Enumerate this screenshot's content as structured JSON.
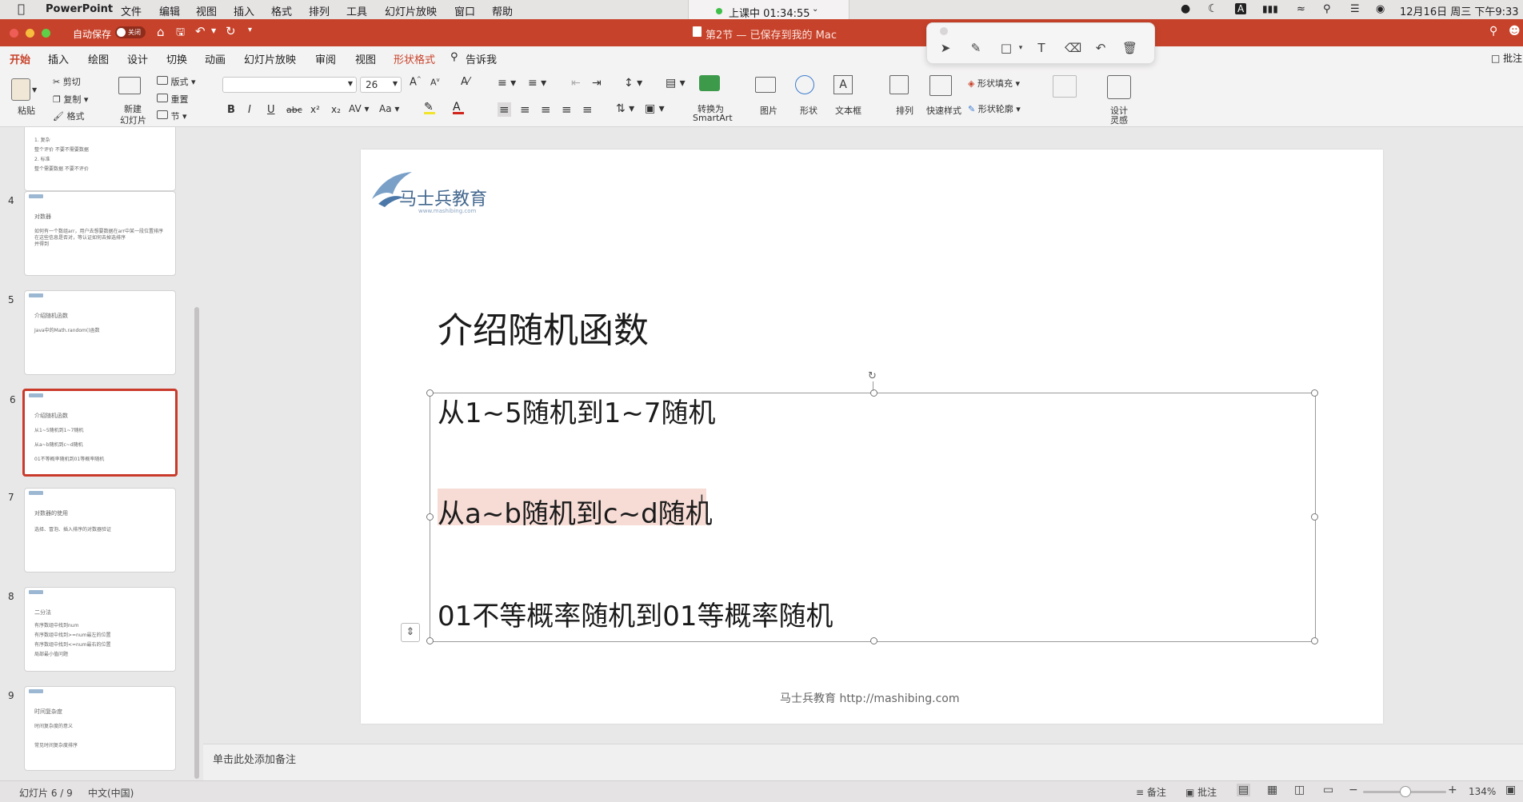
{
  "menubar": {
    "app": "PowerPoint",
    "items": [
      "文件",
      "编辑",
      "视图",
      "插入",
      "格式",
      "排列",
      "工具",
      "幻灯片放映",
      "窗口",
      "帮助"
    ],
    "recording": "上课中 01:34:55",
    "datetime": "12月16日 周三 下午9:33"
  },
  "titlebar": {
    "autosave": "自动保存",
    "toggle": "关闭",
    "title": "第2节 — 已保存到我的 Mac"
  },
  "tabs": [
    "开始",
    "插入",
    "绘图",
    "设计",
    "切换",
    "动画",
    "幻灯片放映",
    "审阅",
    "视图",
    "形状格式"
  ],
  "tell_me": "告诉我",
  "comments_btn": "批注",
  "toolbar": {
    "paste": "粘贴",
    "cut": "剪切",
    "copy": "复制",
    "format": "格式",
    "new_slide_1": "新建",
    "new_slide_2": "幻灯片",
    "layout": "版式",
    "reset": "重置",
    "section": "节",
    "font_name": "",
    "font_size": "26",
    "bold": "B",
    "italic": "I",
    "underline": "U",
    "strike": "abc",
    "sup": "x²",
    "sub": "x₂",
    "smartart_1": "转换为",
    "smartart_2": "SmartArt",
    "picture": "图片",
    "shape": "形状",
    "textbox": "文本框",
    "arrange": "排列",
    "quickstyle": "快速样式",
    "shape_fill": "形状填充",
    "shape_outline": "形状轮廓",
    "design_1": "设计",
    "design_2": "灵感"
  },
  "thumbnails": [
    {
      "num": "",
      "lines": [
        "1. 复杂",
        "整个评价   不要不需要数据",
        "2. 标准",
        "整个需要数据   不要不评价"
      ]
    },
    {
      "num": "4",
      "lines": [
        "对数器",
        "如何有一个数组arr，用户去想要数据在arr中某一段位置排序",
        "在这些信息是否对，等认证如何去掉选排序",
        "并得到"
      ]
    },
    {
      "num": "5",
      "lines": [
        "介绍随机函数",
        "Java中的Math.random()函数"
      ]
    },
    {
      "num": "6",
      "lines": [
        "介绍随机函数",
        "从1~5随机到1~7随机",
        "从a~b随机到c~d随机",
        "01不等概率随机到01等概率随机"
      ]
    },
    {
      "num": "7",
      "lines": [
        "对数器的使用",
        "选择、冒泡、插入排序的对数器验证"
      ]
    },
    {
      "num": "8",
      "lines": [
        "二分法",
        "有序数组中找到num",
        "有序数组中找到>=num最左的位置",
        "有序数组中找到<=num最右的位置",
        "局部最小值问题"
      ]
    },
    {
      "num": "9",
      "lines": [
        "时间复杂度",
        "时间复杂度的意义",
        "常见时间复杂度排序"
      ]
    }
  ],
  "slide": {
    "logo_text": "马士兵教育",
    "logo_url": "www.mashibing.com",
    "title": "介绍随机函数",
    "bullets": [
      "从1~5随机到1~7随机",
      "从a~b随机到c~d随机",
      "01不等概率随机到01等概率随机"
    ],
    "footer": "马士兵教育 http://mashibing.com"
  },
  "notes_placeholder": "单击此处添加备注",
  "status": {
    "slide_index": "幻灯片 6 / 9",
    "language": "中文(中国)",
    "notes": "备注",
    "comments": "批注",
    "zoom": "134%"
  }
}
